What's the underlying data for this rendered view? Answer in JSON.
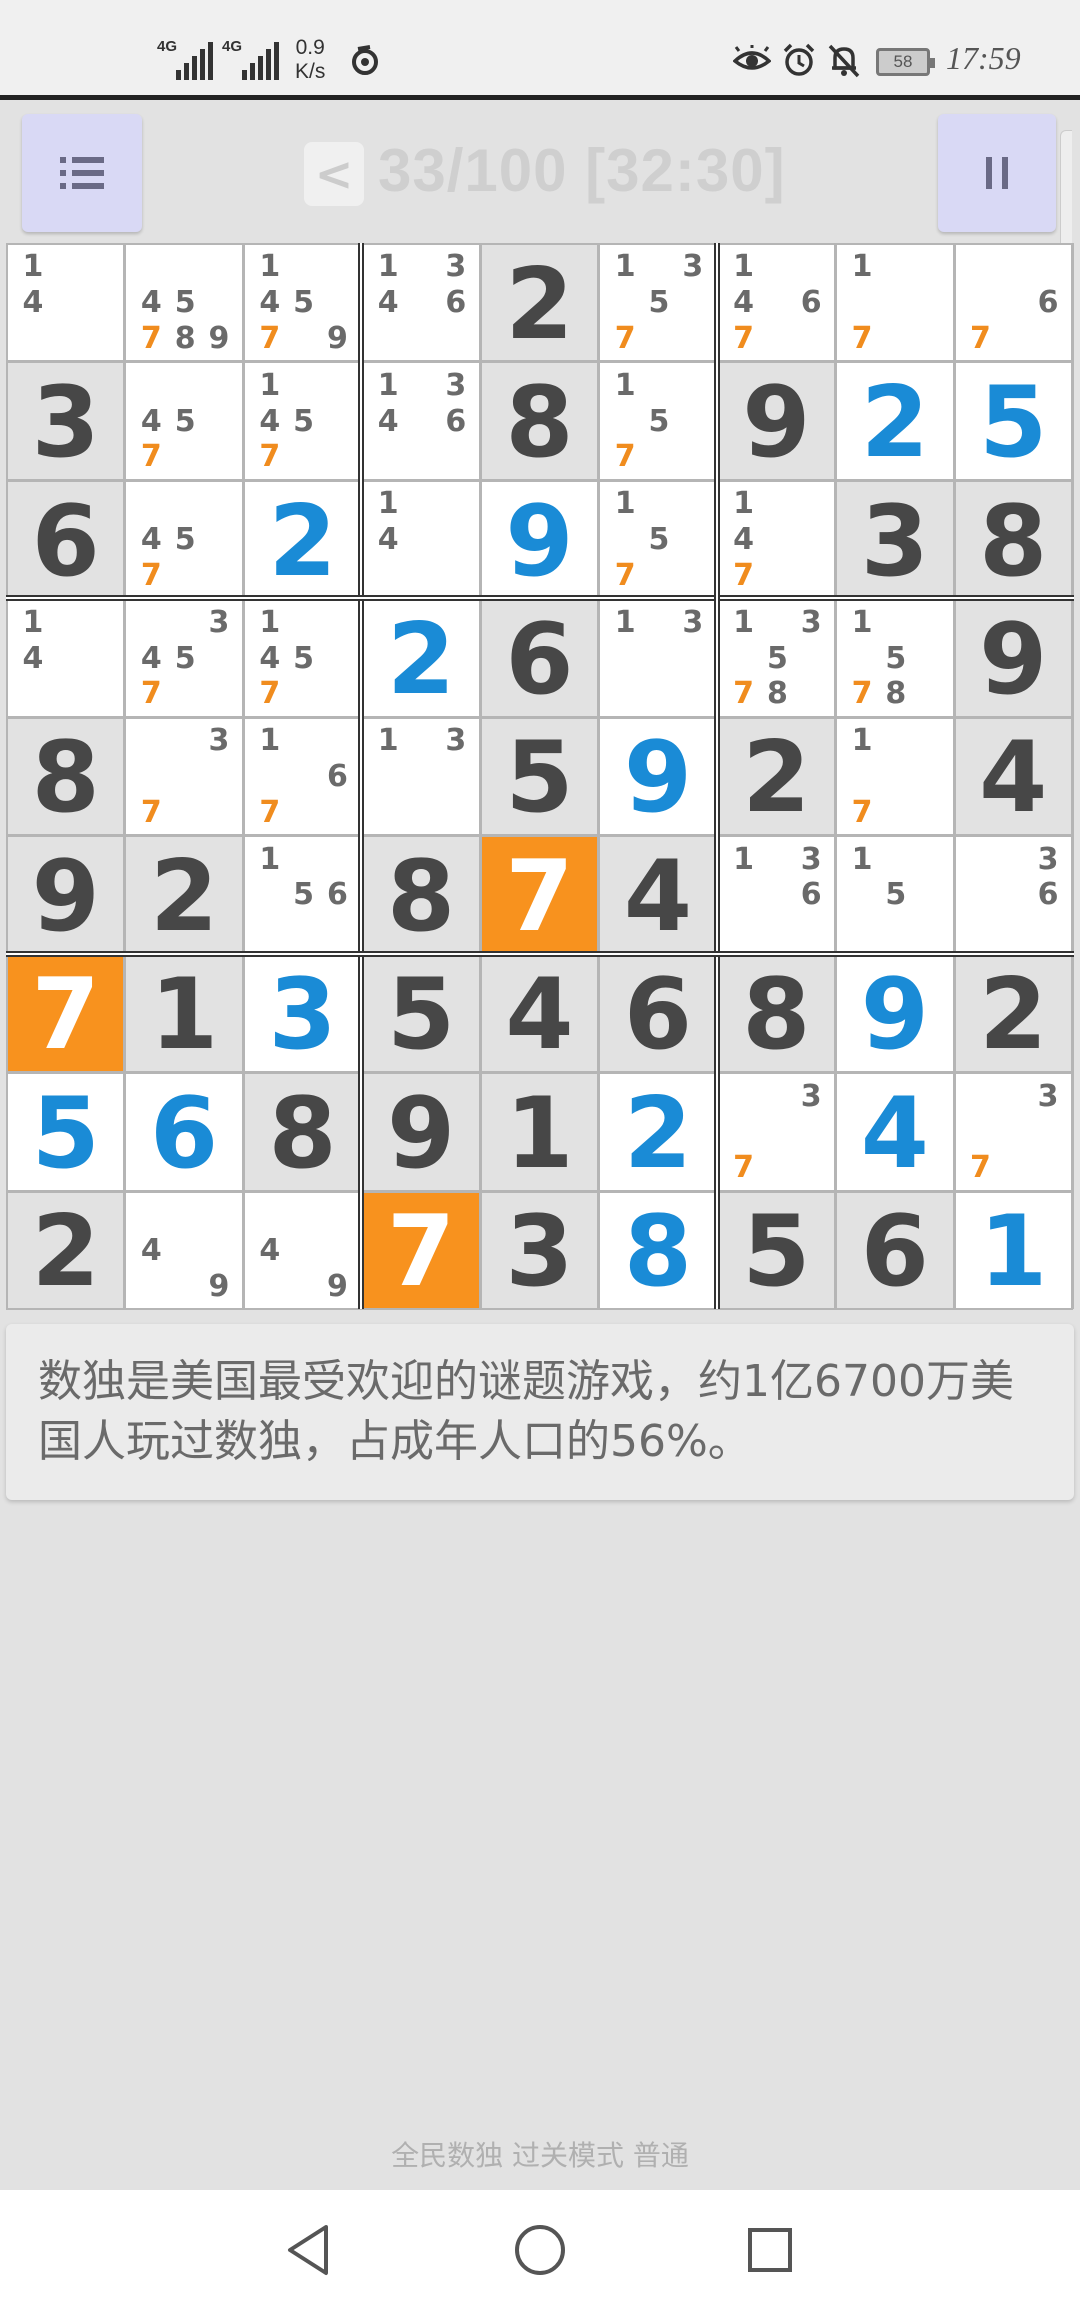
{
  "status_bar": {
    "network_left": "4G",
    "network_right": "4G",
    "net_speed_value": "0.9",
    "net_speed_unit": "K/s",
    "battery_level": "58",
    "time": "17:59"
  },
  "header": {
    "prev_label": "<",
    "level_progress": "33/100 [32:30]"
  },
  "board": {
    "rows": [
      [
        {
          "notes": [
            1,
            4
          ]
        },
        {
          "notes": [
            4,
            5,
            7,
            8,
            9
          ]
        },
        {
          "notes": [
            1,
            4,
            5,
            7,
            9
          ]
        },
        {
          "notes": [
            1,
            3,
            4,
            6
          ]
        },
        {
          "value": "2",
          "type": "given"
        },
        {
          "notes": [
            1,
            3,
            5,
            7
          ]
        },
        {
          "notes": [
            1,
            4,
            6,
            7
          ]
        },
        {
          "notes": [
            1,
            7
          ]
        },
        {
          "notes": [
            6,
            7
          ]
        }
      ],
      [
        {
          "value": "3",
          "type": "given"
        },
        {
          "notes": [
            4,
            5,
            7
          ]
        },
        {
          "notes": [
            1,
            4,
            5,
            7
          ]
        },
        {
          "notes": [
            1,
            3,
            4,
            6
          ]
        },
        {
          "value": "8",
          "type": "given"
        },
        {
          "notes": [
            1,
            5,
            7
          ]
        },
        {
          "value": "9",
          "type": "given"
        },
        {
          "value": "2",
          "type": "entered"
        },
        {
          "value": "5",
          "type": "entered"
        }
      ],
      [
        {
          "value": "6",
          "type": "given"
        },
        {
          "notes": [
            4,
            5,
            7
          ]
        },
        {
          "value": "2",
          "type": "entered"
        },
        {
          "notes": [
            1,
            4
          ]
        },
        {
          "value": "9",
          "type": "entered"
        },
        {
          "notes": [
            1,
            5,
            7
          ]
        },
        {
          "notes": [
            1,
            4,
            7
          ]
        },
        {
          "value": "3",
          "type": "given"
        },
        {
          "value": "8",
          "type": "given"
        }
      ],
      [
        {
          "notes": [
            1,
            4
          ]
        },
        {
          "notes": [
            3,
            4,
            5,
            7
          ]
        },
        {
          "notes": [
            1,
            4,
            5,
            7
          ]
        },
        {
          "value": "2",
          "type": "entered"
        },
        {
          "value": "6",
          "type": "given"
        },
        {
          "notes": [
            1,
            3
          ]
        },
        {
          "notes": [
            1,
            3,
            5,
            7,
            8
          ]
        },
        {
          "notes": [
            1,
            5,
            7,
            8
          ]
        },
        {
          "value": "9",
          "type": "given"
        }
      ],
      [
        {
          "value": "8",
          "type": "given"
        },
        {
          "notes": [
            3,
            7
          ]
        },
        {
          "notes": [
            1,
            6,
            7
          ]
        },
        {
          "notes": [
            1,
            3
          ]
        },
        {
          "value": "5",
          "type": "given"
        },
        {
          "value": "9",
          "type": "entered"
        },
        {
          "value": "2",
          "type": "given"
        },
        {
          "notes": [
            1,
            7
          ]
        },
        {
          "value": "4",
          "type": "given"
        }
      ],
      [
        {
          "value": "9",
          "type": "given"
        },
        {
          "value": "2",
          "type": "given"
        },
        {
          "notes": [
            1,
            5,
            6
          ]
        },
        {
          "value": "8",
          "type": "given"
        },
        {
          "value": "7",
          "type": "selected"
        },
        {
          "value": "4",
          "type": "given"
        },
        {
          "notes": [
            1,
            3,
            6
          ]
        },
        {
          "notes": [
            1,
            5
          ]
        },
        {
          "notes": [
            3,
            6
          ]
        }
      ],
      [
        {
          "value": "7",
          "type": "selected"
        },
        {
          "value": "1",
          "type": "given"
        },
        {
          "value": "3",
          "type": "entered"
        },
        {
          "value": "5",
          "type": "given"
        },
        {
          "value": "4",
          "type": "given"
        },
        {
          "value": "6",
          "type": "given"
        },
        {
          "value": "8",
          "type": "given"
        },
        {
          "value": "9",
          "type": "entered"
        },
        {
          "value": "2",
          "type": "given"
        }
      ],
      [
        {
          "value": "5",
          "type": "entered"
        },
        {
          "value": "6",
          "type": "entered"
        },
        {
          "value": "8",
          "type": "given"
        },
        {
          "value": "9",
          "type": "given"
        },
        {
          "value": "1",
          "type": "given"
        },
        {
          "value": "2",
          "type": "entered"
        },
        {
          "notes": [
            3,
            7
          ]
        },
        {
          "value": "4",
          "type": "entered"
        },
        {
          "notes": [
            3,
            7
          ]
        }
      ],
      [
        {
          "value": "2",
          "type": "given"
        },
        {
          "notes": [
            4,
            9
          ]
        },
        {
          "notes": [
            4,
            9
          ]
        },
        {
          "value": "7",
          "type": "selected"
        },
        {
          "value": "3",
          "type": "given"
        },
        {
          "value": "8",
          "type": "entered"
        },
        {
          "value": "5",
          "type": "given"
        },
        {
          "value": "6",
          "type": "given"
        },
        {
          "value": "1",
          "type": "entered"
        }
      ]
    ]
  },
  "fact": {
    "text": "数独是美国最受欢迎的谜题游戏，约1亿6700万美国人玩过数独，占成年人口的56%。"
  },
  "footer": {
    "label": "全民数独 过关模式 普通"
  },
  "colors": {
    "selected_bg": "#f8921e",
    "entered_digit": "#1a8bd6",
    "given_digit": "#474747",
    "note_highlight": "#f08c1e",
    "header_button_bg": "#d9d9f5"
  },
  "icons": {
    "menu": "list-icon",
    "pause": "pause-icon",
    "nav_back": "triangle-back-icon",
    "nav_home": "circle-home-icon",
    "nav_recent": "square-recents-icon"
  }
}
